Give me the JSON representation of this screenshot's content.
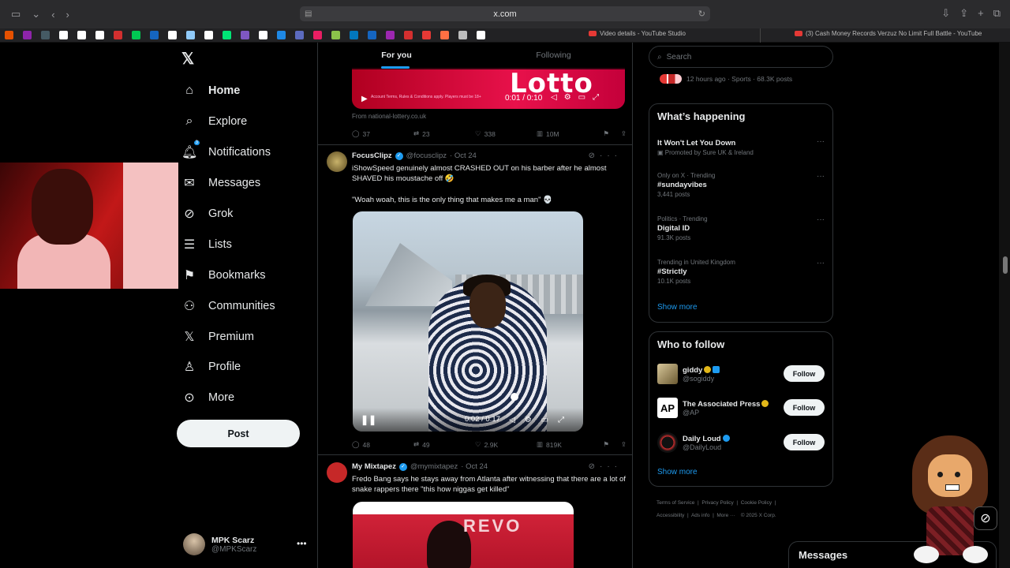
{
  "browser": {
    "url": "x.com",
    "tabs": [
      {
        "title": "Video details - YouTube Studio"
      },
      {
        "title": "(3) Cash Money Records Verzuz No Limit Full Battle - YouTube"
      }
    ],
    "bookmark_colors": [
      "#e65100",
      "#8e24aa",
      "#455a64",
      "#ffffff",
      "#ffffff",
      "#ffffff",
      "#d32f2f",
      "#00c853",
      "#1565c0",
      "#ffffff",
      "#90caf9",
      "#ffffff",
      "#00e676",
      "#7e57c2",
      "#ffffff",
      "#1e88e5",
      "#5c6bc0",
      "#e91e63",
      "#8bc34a",
      "#0277bd",
      "#1565c0",
      "#9c27b0",
      "#d32f2f",
      "#e53935",
      "#ff7043",
      "#bdbdbd",
      "#ffffff"
    ]
  },
  "sidebar": {
    "logo": "𝕏",
    "items": [
      {
        "label": "Home",
        "icon": "home-icon",
        "glyph": "⌂"
      },
      {
        "label": "Explore",
        "icon": "search-icon",
        "glyph": "⌕"
      },
      {
        "label": "Notifications",
        "icon": "bell-icon",
        "glyph": "🔔︎",
        "badge": "3"
      },
      {
        "label": "Messages",
        "icon": "envelope-icon",
        "glyph": "✉"
      },
      {
        "label": "Grok",
        "icon": "grok-icon",
        "glyph": "⊘"
      },
      {
        "label": "Lists",
        "icon": "list-icon",
        "glyph": "☰"
      },
      {
        "label": "Bookmarks",
        "icon": "bookmark-icon",
        "glyph": "⚑"
      },
      {
        "label": "Communities",
        "icon": "communities-icon",
        "glyph": "⚇"
      },
      {
        "label": "Premium",
        "icon": "x-premium-icon",
        "glyph": "𝕏"
      },
      {
        "label": "Profile",
        "icon": "profile-icon",
        "glyph": "♙"
      },
      {
        "label": "More",
        "icon": "more-circle-icon",
        "glyph": "⊙"
      }
    ],
    "post_label": "Post",
    "account": {
      "name": "MPK Scarz",
      "handle": "@MPKScarz",
      "menu": "•••"
    }
  },
  "feed": {
    "tabs": [
      "For you",
      "Following"
    ],
    "prev_post": {
      "video_word": "Lotto",
      "fine_print": "Account Terms, Rules & Conditions apply. Players must be 18+",
      "time": "0:01 / 0:10",
      "source": "From national-lottery.co.uk",
      "replies": "37",
      "reposts": "23",
      "likes": "338",
      "views": "10M"
    },
    "posts": [
      {
        "name": "FocusClipz",
        "handle": "@focusclipz",
        "date": "· Oct 24",
        "text": "iShowSpeed genuinely almost CRASHED OUT on his barber after he almost SHAVED his moustache off 🤣",
        "text2": "\"Woah woah, this is the only thing that makes me a man\" 💀",
        "video_time": "0:02 / 0:17",
        "replies": "48",
        "reposts": "49",
        "likes": "2.9K",
        "views": "819K"
      },
      {
        "name": "My Mixtapez",
        "handle": "@mymixtapez",
        "date": "· Oct 24",
        "text": "Fredo Bang says he stays away from Atlanta after witnessing that there are a lot of snake rappers there \"this how niggas get killed\"",
        "image_word": "REVO"
      }
    ]
  },
  "right": {
    "search_placeholder": "Search",
    "top_meta": "12 hours ago · Sports · 68.3K posts",
    "happening_title": "What’s happening",
    "trends": [
      {
        "cat": "",
        "name": "It Won't Let You Down",
        "cnt": "Promoted by Sure UK & Ireland"
      },
      {
        "cat": "Only on X · Trending",
        "name": "#sundayvibes",
        "cnt": "3,441 posts"
      },
      {
        "cat": "Politics · Trending",
        "name": "Digital ID",
        "cnt": "91.3K posts"
      },
      {
        "cat": "Trending in United Kingdom",
        "name": "#Strictly",
        "cnt": "10.1K posts"
      }
    ],
    "show_more": "Show more",
    "wtf_title": "Who to follow",
    "wtf": [
      {
        "name": "giddy",
        "handle": "@sogiddy",
        "follow": "Follow"
      },
      {
        "name": "The Associated Press",
        "handle": "@AP",
        "follow": "Follow"
      },
      {
        "name": "Daily Loud",
        "handle": "@DailyLoud",
        "follow": "Follow"
      }
    ],
    "footer": [
      "Terms of Service",
      "Privacy Policy",
      "Cookie Policy",
      "Accessibility",
      "Ads info",
      "More ···",
      "© 2025 X Corp."
    ],
    "messages": "Messages"
  }
}
